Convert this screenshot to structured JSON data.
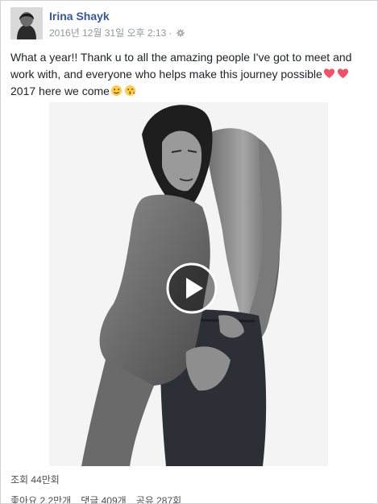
{
  "post": {
    "author": "Irina Shayk",
    "timestamp": "2016년 12월 31일 오후 2:13",
    "separator": "·",
    "privacy_icon": "gear-icon",
    "text_line1": "What a year!! Thank u to all the amazing people I've got to meet and",
    "text_line2": "work with, and everyone who helps make this journey possible",
    "text_line3": "2017 here we come",
    "emojis_line2": [
      "heart-icon",
      "heart-icon"
    ],
    "emojis_line3": [
      "wink-face-icon",
      "kiss-face-icon"
    ]
  },
  "video": {
    "play_icon": "play-icon"
  },
  "stats": {
    "views": "조회 44만회",
    "likes": "좋아요 2.2만개",
    "comments": "댓글 409개",
    "shares": "공유 287회"
  },
  "colors": {
    "author_link": "#365899",
    "meta": "#90949c",
    "text": "#1d2129",
    "heart": "#f25268",
    "emoji_face": "#ffcc4d"
  }
}
